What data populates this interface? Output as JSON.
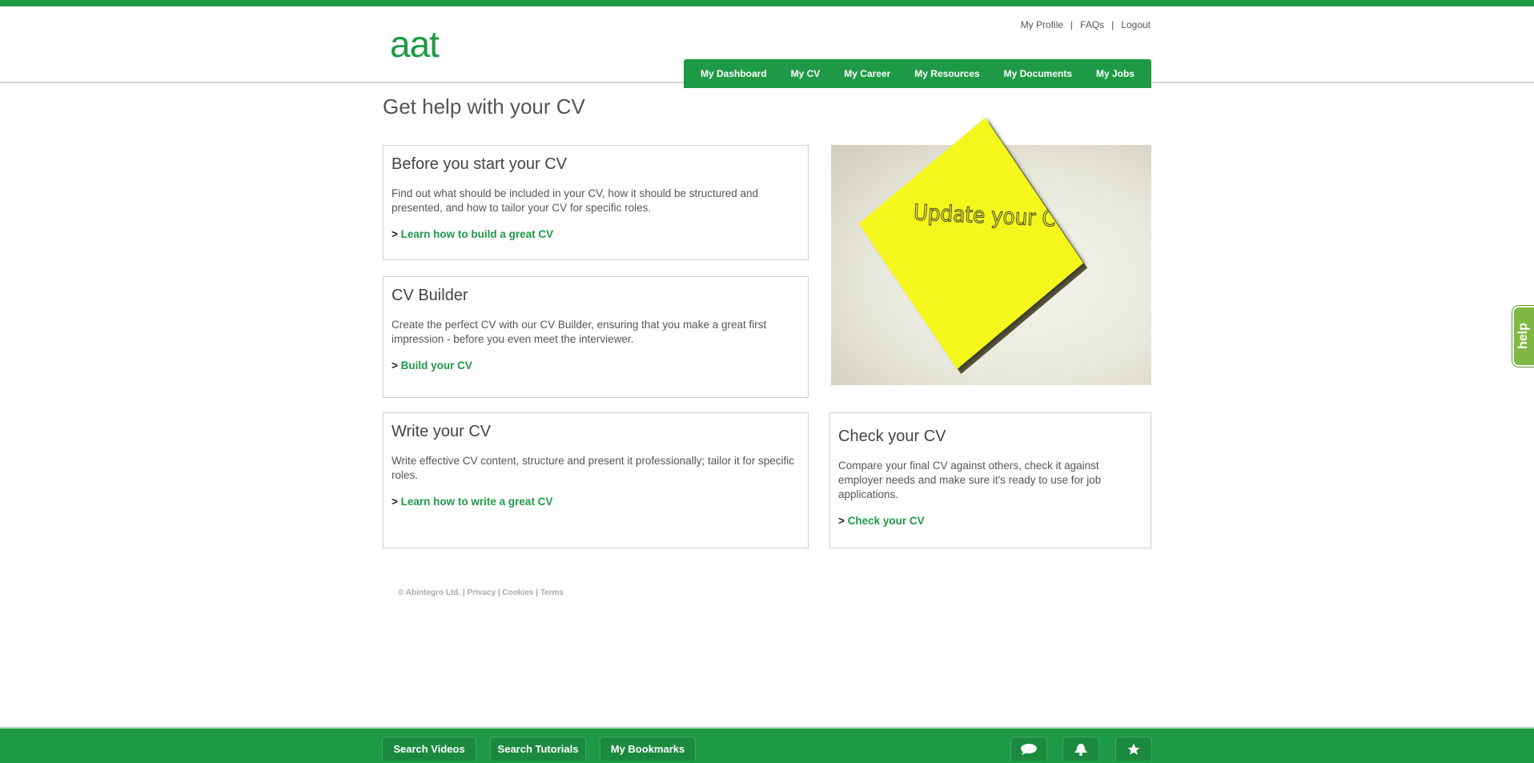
{
  "header": {
    "logo_text": "aat",
    "util_links": [
      "My Profile",
      "FAQs",
      "Logout"
    ],
    "nav": [
      "My Dashboard",
      "My CV",
      "My Career",
      "My Resources",
      "My Documents",
      "My Jobs"
    ]
  },
  "page": {
    "title": "Get help with your CV"
  },
  "cards": [
    {
      "title": "Before you start your CV",
      "text": "Find out what should be included in your CV, how it should be structured and presented, and how to tailor your CV for specific roles.",
      "prefix": ">",
      "link": "Learn how to build a great CV"
    },
    {
      "title": "CV Builder",
      "text": "Create the perfect CV with our CV Builder, ensuring that you make a great first impression - before you even meet the interviewer.",
      "prefix": ">",
      "link": "Build your CV"
    },
    {
      "title": "Write your CV",
      "text": "Write effective CV content, structure and present it professionally; tailor it for specific roles.",
      "prefix": ">",
      "link": "Learn how to write a great CV"
    },
    {
      "title": "Check your CV",
      "text": "Compare your final CV against others, check it against employer needs and make sure it's ready to use for job applications.",
      "prefix": ">",
      "link": "Check your CV"
    }
  ],
  "image": {
    "note_text": "Update your CV!"
  },
  "footer": {
    "copyright": "© Abintegro Ltd.",
    "links": [
      "Privacy",
      "Cookies",
      "Terms"
    ]
  },
  "help_tab": {
    "label": "help"
  },
  "bottom_bar": {
    "buttons": [
      "Search Videos",
      "Search Tutorials",
      "My Bookmarks"
    ],
    "icons": [
      "chat-icon",
      "notification-bell-icon",
      "star-icon"
    ]
  },
  "colors": {
    "brand_green": "#1e9a46",
    "help_green": "#7fb844"
  }
}
